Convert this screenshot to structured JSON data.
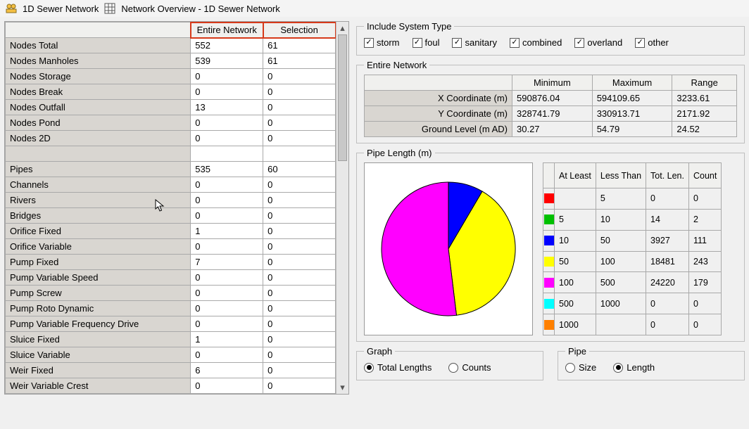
{
  "window": {
    "title1": "1D Sewer Network",
    "title2": "Network Overview - 1D Sewer Network"
  },
  "stats_header": {
    "col1": "Entire Network",
    "col2": "Selection"
  },
  "stats_rows": [
    {
      "label": "Nodes Total",
      "en": "552",
      "sel": "61"
    },
    {
      "label": "Nodes Manholes",
      "en": "539",
      "sel": "61"
    },
    {
      "label": "Nodes Storage",
      "en": "0",
      "sel": "0"
    },
    {
      "label": "Nodes Break",
      "en": "0",
      "sel": "0"
    },
    {
      "label": "Nodes Outfall",
      "en": "13",
      "sel": "0"
    },
    {
      "label": "Nodes Pond",
      "en": "0",
      "sel": "0"
    },
    {
      "label": "Nodes 2D",
      "en": "0",
      "sel": "0"
    },
    {
      "label": "",
      "en": "",
      "sel": ""
    },
    {
      "label": "Pipes",
      "en": "535",
      "sel": "60"
    },
    {
      "label": "Channels",
      "en": "0",
      "sel": "0"
    },
    {
      "label": "Rivers",
      "en": "0",
      "sel": "0"
    },
    {
      "label": "Bridges",
      "en": "0",
      "sel": "0"
    },
    {
      "label": "Orifice Fixed",
      "en": "1",
      "sel": "0"
    },
    {
      "label": "Orifice Variable",
      "en": "0",
      "sel": "0"
    },
    {
      "label": "Pump Fixed",
      "en": "7",
      "sel": "0"
    },
    {
      "label": "Pump Variable Speed",
      "en": "0",
      "sel": "0"
    },
    {
      "label": "Pump Screw",
      "en": "0",
      "sel": "0"
    },
    {
      "label": "Pump Roto Dynamic",
      "en": "0",
      "sel": "0"
    },
    {
      "label": "Pump Variable Frequency Drive",
      "en": "0",
      "sel": "0"
    },
    {
      "label": "Sluice Fixed",
      "en": "1",
      "sel": "0"
    },
    {
      "label": "Sluice Variable",
      "en": "0",
      "sel": "0"
    },
    {
      "label": "Weir Fixed",
      "en": "6",
      "sel": "0"
    },
    {
      "label": "Weir Variable Crest",
      "en": "0",
      "sel": "0"
    }
  ],
  "system_type": {
    "legend": "Include System Type",
    "items": [
      {
        "label": "storm",
        "checked": true
      },
      {
        "label": "foul",
        "checked": true
      },
      {
        "label": "sanitary",
        "checked": true
      },
      {
        "label": "combined",
        "checked": true
      },
      {
        "label": "overland",
        "checked": true
      },
      {
        "label": "other",
        "checked": true
      }
    ]
  },
  "extents": {
    "legend": "Entire Network",
    "header": {
      "min": "Minimum",
      "max": "Maximum",
      "range": "Range"
    },
    "rows": [
      {
        "label": "X Coordinate (m)",
        "min": "590876.04",
        "max": "594109.65",
        "range": "3233.61"
      },
      {
        "label": "Y Coordinate (m)",
        "min": "328741.79",
        "max": "330913.71",
        "range": "2171.92"
      },
      {
        "label": "Ground Level (m AD)",
        "min": "30.27",
        "max": "54.79",
        "range": "24.52"
      }
    ]
  },
  "pipe_length": {
    "legend": "Pipe Length (m)",
    "header": {
      "atleast": "At Least",
      "lessthan": "Less Than",
      "totlen": "Tot. Len.",
      "count": "Count"
    },
    "rows": [
      {
        "color": "#ff0000",
        "atleast": "",
        "lessthan": "5",
        "totlen": "0",
        "count": "0"
      },
      {
        "color": "#00c000",
        "atleast": "5",
        "lessthan": "10",
        "totlen": "14",
        "count": "2"
      },
      {
        "color": "#0000ff",
        "atleast": "10",
        "lessthan": "50",
        "totlen": "3927",
        "count": "111"
      },
      {
        "color": "#ffff00",
        "atleast": "50",
        "lessthan": "100",
        "totlen": "18481",
        "count": "243"
      },
      {
        "color": "#ff00ff",
        "atleast": "100",
        "lessthan": "500",
        "totlen": "24220",
        "count": "179"
      },
      {
        "color": "#00ffff",
        "atleast": "500",
        "lessthan": "1000",
        "totlen": "0",
        "count": "0"
      },
      {
        "color": "#ff8000",
        "atleast": "1000",
        "lessthan": "",
        "totlen": "0",
        "count": "0"
      }
    ]
  },
  "graph": {
    "legend": "Graph",
    "options": [
      {
        "label": "Total Lengths",
        "selected": true
      },
      {
        "label": "Counts",
        "selected": false
      }
    ]
  },
  "pipe": {
    "legend": "Pipe",
    "options": [
      {
        "label": "Size",
        "selected": false
      },
      {
        "label": "Length",
        "selected": true
      }
    ]
  },
  "chart_data": {
    "type": "pie",
    "title": "Pipe Length (m)",
    "series": [
      {
        "name": "< 5",
        "value": 0,
        "color": "#ff0000"
      },
      {
        "name": "5 – 10",
        "value": 14,
        "color": "#00c000"
      },
      {
        "name": "10 – 50",
        "value": 3927,
        "color": "#0000ff"
      },
      {
        "name": "50 – 100",
        "value": 18481,
        "color": "#ffff00"
      },
      {
        "name": "100 – 500",
        "value": 24220,
        "color": "#ff00ff"
      },
      {
        "name": "500 – 1000",
        "value": 0,
        "color": "#00ffff"
      },
      {
        "name": ">= 1000",
        "value": 0,
        "color": "#ff8000"
      }
    ]
  }
}
